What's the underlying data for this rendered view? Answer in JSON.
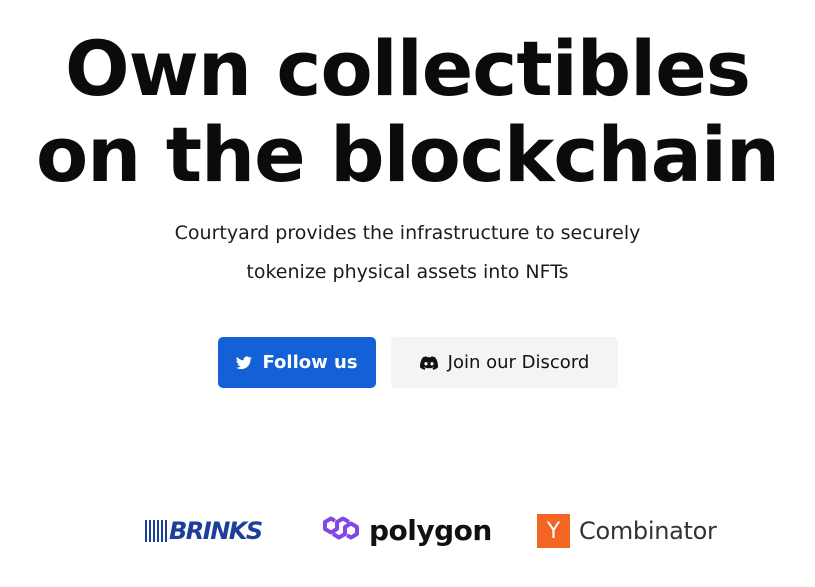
{
  "hero": {
    "headline_line1": "Own collectibles",
    "headline_line2": "on the blockchain",
    "subtext_line1": "Courtyard provides the infrastructure to securely",
    "subtext_line2": "tokenize physical assets into NFTs"
  },
  "buttons": {
    "follow": {
      "label": "Follow us",
      "icon": "twitter-icon",
      "color": "#1460d6"
    },
    "discord": {
      "label": "Join our Discord",
      "icon": "discord-icon",
      "color": "#f3f4f6"
    }
  },
  "partners": {
    "brinks": {
      "label": "BRINKS",
      "color": "#1d3f9a"
    },
    "polygon": {
      "label": "polygon",
      "icon": "polygon-icon",
      "color": "#8247e5"
    },
    "ycombinator": {
      "mark": "Y",
      "label": "Combinator",
      "color": "#f26522"
    }
  }
}
